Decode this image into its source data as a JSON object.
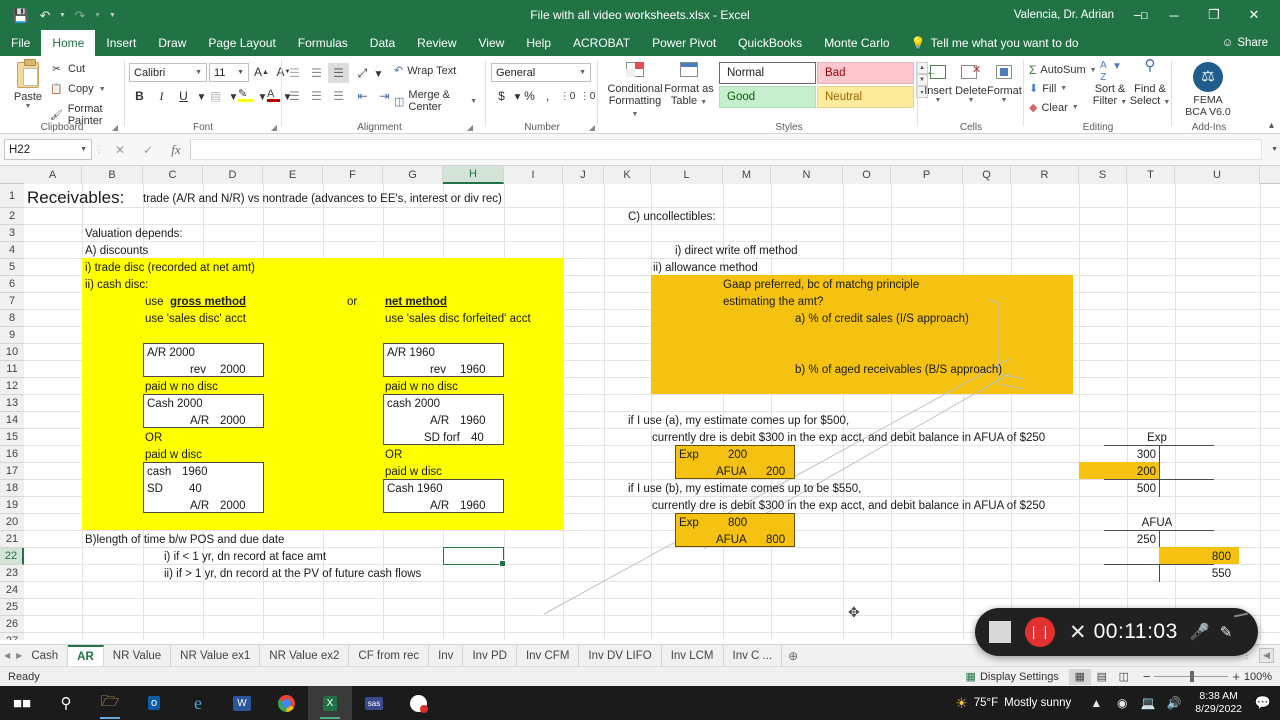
{
  "titlebar": {
    "filename": "File with all video worksheets.xlsx  -  Excel",
    "account": "Valencia, Dr. Adrian",
    "qat": [
      "save-icon",
      "undo-icon",
      "redo-icon",
      "customize-icon"
    ],
    "ribbon_display_icon": "ribbon-display-options-icon",
    "minimize": "─",
    "restore": "❐",
    "close": "✕"
  },
  "ribbon_tabs": {
    "items": [
      "File",
      "Home",
      "Insert",
      "Draw",
      "Page Layout",
      "Formulas",
      "Data",
      "Review",
      "View",
      "Help",
      "ACROBAT",
      "Power Pivot",
      "QuickBooks",
      "Monte Carlo"
    ],
    "active": "Home",
    "tellme": "Tell me what you want to do",
    "share": "Share"
  },
  "ribbon": {
    "clipboard": {
      "label": "Clipboard",
      "paste": "Paste",
      "cut": "Cut",
      "copy": "Copy",
      "format_painter": "Format Painter"
    },
    "font": {
      "label": "Font",
      "family": "Calibri",
      "size": "11",
      "grow": "A",
      "shrink": "A",
      "bold": "B",
      "italic": "I",
      "underline": "U"
    },
    "alignment": {
      "label": "Alignment",
      "wrap_text": "Wrap Text",
      "merge_center": "Merge & Center"
    },
    "number": {
      "label": "Number",
      "format": "General",
      "currency": "$",
      "percent": "%",
      "comma": ","
    },
    "styles": {
      "label": "Styles",
      "conditional_formatting": "Conditional Formatting",
      "format_as_table": "Format as Table",
      "cells": [
        {
          "name": "Normal",
          "bg": "#ffffff",
          "fg": "#222222"
        },
        {
          "name": "Bad",
          "bg": "#ffc7ce",
          "fg": "#9c0006"
        },
        {
          "name": "Good",
          "bg": "#c6efce",
          "fg": "#006100"
        },
        {
          "name": "Neutral",
          "bg": "#ffeb9c",
          "fg": "#9c6500"
        }
      ]
    },
    "cells_group": {
      "label": "Cells",
      "insert": "Insert",
      "delete": "Delete",
      "format": "Format"
    },
    "editing": {
      "label": "Editing",
      "autosum": "AutoSum",
      "fill": "Fill",
      "clear": "Clear",
      "sort_filter": "Sort & Filter",
      "find_select": "Find & Select"
    },
    "addins": {
      "label": "Add-Ins",
      "name_line1": "FEMA",
      "name_line2": "BCA V6.0"
    }
  },
  "formula_bar": {
    "name_box": "H22",
    "cancel_icon": "✕",
    "enter_icon": "✓",
    "fx_icon": "fx",
    "formula": ""
  },
  "grid": {
    "columns": [
      "A",
      "B",
      "C",
      "D",
      "E",
      "F",
      "G",
      "H",
      "I",
      "J",
      "K",
      "L",
      "M",
      "N",
      "O",
      "P",
      "Q",
      "R",
      "S",
      "T",
      "U"
    ],
    "selected_column": "H",
    "rows": [
      "1",
      "2",
      "3",
      "4",
      "5",
      "6",
      "7",
      "8",
      "9",
      "10",
      "11",
      "12",
      "13",
      "14",
      "15",
      "16",
      "17",
      "18",
      "19",
      "20",
      "21",
      "22",
      "23",
      "24",
      "25",
      "26",
      "27"
    ],
    "selected_row": "22",
    "selected_cell": "H22",
    "highlight_yellow": "#ffff00",
    "highlight_gold": "#f5c211"
  },
  "sheet_cells": {
    "title": "Receivables:",
    "title_note": "trade (A/R and N/R) vs nontrade (advances to EE's, interest or div rec)",
    "valuation_depends": "Valuation depends:",
    "a_discounts": "A) discounts",
    "trade_disc": "i) trade disc (recorded at net amt)",
    "cash_disc": "ii) cash disc:",
    "use_gross": "use ",
    "gross_method": "gross method",
    "or_word": "or",
    "net_method": "net method",
    "sales_disc_acct": "use 'sales disc' acct",
    "sales_disc_forf_acct": "use 'sales disc forfeited' acct",
    "gross_je1_l1": "A/R 2000",
    "gross_je1_l2_label": "rev",
    "gross_je1_l2_val": "2000",
    "net_je1_l1": "A/R 1960",
    "net_je1_l2_label": "rev",
    "net_je1_l2_val": "1960",
    "paid_no_disc_left": "paid w no disc",
    "paid_no_disc_right": "paid w no disc",
    "g_nod_l1": "Cash  2000",
    "g_nod_l2_label": "A/R",
    "g_nod_l2_val": "2000",
    "n_nod_l1": "cash  2000",
    "n_nod_l2_label": "A/R",
    "n_nod_l2_val": "1960",
    "n_nod_l3_label": "SD forf",
    "n_nod_l3_val": "40",
    "or_left": "OR",
    "or_right": "OR",
    "paid_disc_left": "paid w disc",
    "paid_disc_right": "paid w disc",
    "g_wd_l1_label": "cash",
    "g_wd_l1_val": "1960",
    "g_wd_l2_label": "SD",
    "g_wd_l2_val": "40",
    "g_wd_l3_label": "A/R",
    "g_wd_l3_val": "2000",
    "n_wd_l1": "Cash  1960",
    "n_wd_l2_label": "A/R",
    "n_wd_l2_val": "1960",
    "b_length": "B)length of time b/w POS and due date",
    "b_i": "i) if < 1 yr, dn record at face amt",
    "b_ii": "ii) if > 1 yr, dn record at the PV of future cash flows",
    "c_uncollectibles": "C) uncollectibles:",
    "c_i": "i) direct write off method",
    "c_ii": "ii) allowance method",
    "gaap": "Gaap preferred, bc of matchg principle",
    "estimating": "estimating the amt?",
    "approach_a": "a)  % of credit sales (I/S approach)",
    "approach_b": "b) % of aged receivables (B/S approach)",
    "use_a_line1": "if I use (a), my estimate comes up for $500,",
    "use_a_line2": "currently dre is debit $300 in the exp acct, and debit balance in AFUA of $250",
    "je_a_exp_label": "Exp",
    "je_a_exp_val": "200",
    "je_a_afua_label": "AFUA",
    "je_a_afua_val": "200",
    "use_b_line1": "if I use (b), my estimate comes up to be $550,",
    "use_b_line2": "currently dre is debit $300 in the exp acct, and debit balance in AFUA of $250",
    "je_b_exp_label": "Exp",
    "je_b_exp_val": "800",
    "je_b_afua_label": "AFUA",
    "je_b_afua_val": "800",
    "t_exp_title": "Exp",
    "t_exp_v1": "300",
    "t_exp_v2": "200",
    "t_exp_v3": "500",
    "t_afua_title": "AFUA",
    "t_afua_v1": "250",
    "t_afua_v2": "800",
    "t_afua_v3": "550"
  },
  "sheet_tabs": {
    "items": [
      "Cash",
      "AR",
      "NR Value",
      "NR Value ex1",
      "NR Value ex2",
      "CF from rec",
      "Inv",
      "Inv PD",
      "Inv CFM",
      "Inv DV LIFO",
      "Inv LCM",
      "Inv C ..."
    ],
    "active": "AR",
    "add_label": "⊕"
  },
  "status_bar": {
    "ready": "Ready",
    "display_settings": "Display Settings",
    "views": [
      "normal-view-icon",
      "page-layout-view-icon",
      "page-break-view-icon"
    ],
    "active_view": "normal-view-icon",
    "zoom_out": "−",
    "zoom_in": "+",
    "zoom": "100%"
  },
  "recorder": {
    "stop": "stop-button",
    "pause": "❘❘",
    "close": "✕",
    "elapsed": "00:11:03",
    "mic": "microphone-icon",
    "pen": "pen-icon"
  },
  "taskbar": {
    "start": "start-icon",
    "search": "search-icon",
    "apps": [
      "file-explorer-icon",
      "outlook-icon",
      "internet-explorer-icon",
      "word-icon",
      "chrome-icon",
      "excel-icon",
      "sas-icon",
      "camtasia-icon"
    ],
    "weather_temp": "75°F",
    "weather_desc": "Mostly sunny",
    "tray": [
      "chevron-up-icon",
      "onedrive-icon",
      "network-icon",
      "volume-icon"
    ],
    "time": "8:38 AM",
    "date": "8/29/2022",
    "notifications": "notification-icon"
  }
}
